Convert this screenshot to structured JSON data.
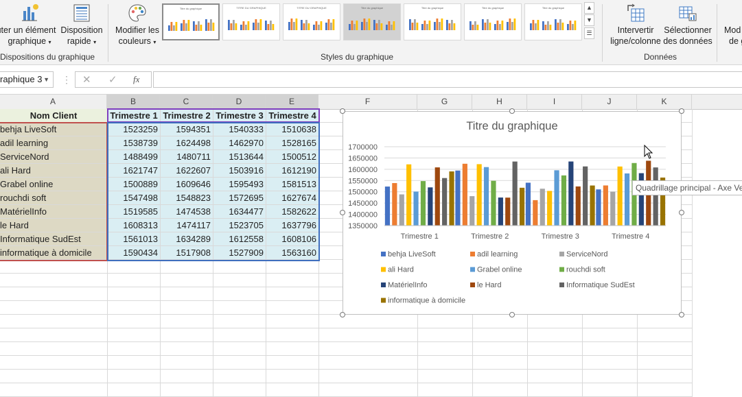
{
  "ribbon": {
    "add_element": {
      "line1": "uter un élément",
      "line2": "graphique"
    },
    "quick_layout": {
      "line1": "Disposition",
      "line2": "rapide"
    },
    "change_colors": {
      "line1": "Modifier les",
      "line2": "couleurs"
    },
    "switch_row_col": {
      "line1": "Intervertir",
      "line2": "ligne/colonne"
    },
    "select_data": {
      "line1": "Sélectionner",
      "line2": "des données"
    },
    "change_type": {
      "line1": "Mod",
      "line2": "de g"
    },
    "groups": {
      "layouts": "Dispositions du graphique",
      "styles": "Styles du graphique",
      "data": "Données"
    },
    "style_thumbs": [
      "Titre du graphique",
      "TITRE DU GRAPHIQUE",
      "TITRE DU GRAPHIQUE",
      "Titre du graphique",
      "Titre du graphique",
      "Titre du graphique",
      "Titre du graphique"
    ]
  },
  "formula_bar": {
    "name_box": "raphique 3",
    "fx": "fx",
    "cancel": "✕",
    "enter": "✓",
    "value": ""
  },
  "columns": [
    "A",
    "B",
    "C",
    "D",
    "E",
    "F",
    "G",
    "H",
    "I",
    "J",
    "K"
  ],
  "table": {
    "headers": [
      "Nom Client",
      "Trimestre 1",
      "Trimestre 2",
      "Trimestre 3",
      "Trimestre 4"
    ],
    "rows": [
      [
        "behja LiveSoft",
        "1523259",
        "1594351",
        "1540333",
        "1510638"
      ],
      [
        "adil learning",
        "1538739",
        "1624498",
        "1462970",
        "1528165"
      ],
      [
        "ServiceNord",
        "1488499",
        "1480711",
        "1513644",
        "1500512"
      ],
      [
        "ali Hard",
        "1621747",
        "1622607",
        "1503916",
        "1612190"
      ],
      [
        "Grabel online",
        "1500889",
        "1609646",
        "1595493",
        "1581513"
      ],
      [
        "rouchdi soft",
        "1547498",
        "1548823",
        "1572695",
        "1627674"
      ],
      [
        "MatérielInfo",
        "1519585",
        "1474538",
        "1634477",
        "1582622"
      ],
      [
        "le Hard",
        "1608313",
        "1474117",
        "1523705",
        "1637796"
      ],
      [
        "Informatique SudEst",
        "1561013",
        "1634289",
        "1612558",
        "1608106"
      ],
      [
        "informatique à domicile",
        "1590434",
        "1517908",
        "1527909",
        "1563160"
      ]
    ]
  },
  "tooltip": "Quadrillage principal - Axe Ve",
  "colors": {
    "accent_green": "#217346",
    "cell_name_bg": "#ddd9c4",
    "cell_val_bg": "#daeef3"
  },
  "chart_data": {
    "type": "bar",
    "title": "Titre du graphique",
    "categories": [
      "Trimestre 1",
      "Trimestre 2",
      "Trimestre 3",
      "Trimestre 4"
    ],
    "ylim": [
      1350000,
      1700000
    ],
    "yticks": [
      "1350000",
      "1400000",
      "1450000",
      "1500000",
      "1550000",
      "1600000",
      "1650000",
      "1700000"
    ],
    "grid": true,
    "legend_position": "bottom",
    "series": [
      {
        "name": "behja LiveSoft",
        "color": "#4472c4",
        "values": [
          1523259,
          1594351,
          1540333,
          1510638
        ]
      },
      {
        "name": "adil learning",
        "color": "#ed7d31",
        "values": [
          1538739,
          1624498,
          1462970,
          1528165
        ]
      },
      {
        "name": "ServiceNord",
        "color": "#a5a5a5",
        "values": [
          1488499,
          1480711,
          1513644,
          1500512
        ]
      },
      {
        "name": "ali Hard",
        "color": "#ffc000",
        "values": [
          1621747,
          1622607,
          1503916,
          1612190
        ]
      },
      {
        "name": "Grabel online",
        "color": "#5b9bd5",
        "values": [
          1500889,
          1609646,
          1595493,
          1581513
        ]
      },
      {
        "name": "rouchdi soft",
        "color": "#70ad47",
        "values": [
          1547498,
          1548823,
          1572695,
          1627674
        ]
      },
      {
        "name": "MatérielInfo",
        "color": "#264478",
        "values": [
          1519585,
          1474538,
          1634477,
          1582622
        ]
      },
      {
        "name": "le Hard",
        "color": "#9e480e",
        "values": [
          1608313,
          1474117,
          1523705,
          1637796
        ]
      },
      {
        "name": "Informatique SudEst",
        "color": "#636363",
        "values": [
          1561013,
          1634289,
          1612558,
          1608106
        ]
      },
      {
        "name": "informatique à domicile",
        "color": "#997300",
        "values": [
          1590434,
          1517908,
          1527909,
          1563160
        ]
      }
    ]
  }
}
